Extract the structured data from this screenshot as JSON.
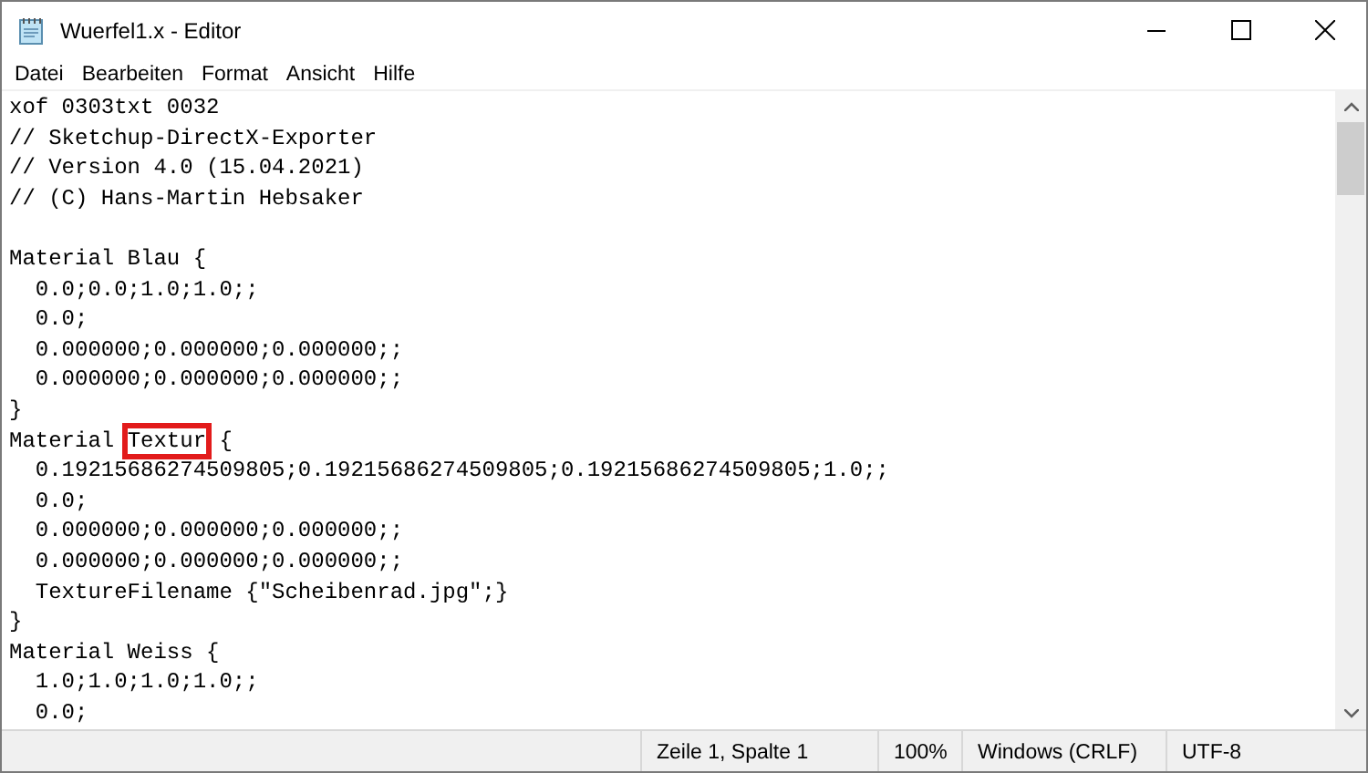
{
  "window": {
    "title": "Wuerfel1.x - Editor"
  },
  "menu": [
    "Datei",
    "Bearbeiten",
    "Format",
    "Ansicht",
    "Hilfe"
  ],
  "blocks": [
    [
      {
        "text": "xof 0303txt 0032"
      },
      {
        "text": "// Sketchup-DirectX-Exporter"
      },
      {
        "text": "// Version 4.0 (15.04.2021)"
      },
      {
        "text": "// (C) Hans-Martin Hebsaker"
      }
    ],
    [
      {
        "text": "Material Blau {"
      },
      {
        "text": "  0.0;0.0;1.0;1.0;;"
      },
      {
        "text": "  0.0;"
      },
      {
        "text": "  0.000000;0.000000;0.000000;;"
      },
      {
        "text": "  0.000000;0.000000;0.000000;;"
      },
      {
        "text": "}"
      },
      {
        "text": "Material ",
        "marked": "Textur",
        "after": " {"
      },
      {
        "text": "  0.19215686274509805;0.19215686274509805;0.19215686274509805;1.0;;"
      },
      {
        "text": "  0.0;"
      },
      {
        "text": "  0.000000;0.000000;0.000000;;"
      },
      {
        "text": "  0.000000;0.000000;0.000000;;"
      },
      {
        "text": "  TextureFilename {\"Scheibenrad.jpg\";}"
      },
      {
        "text": "}"
      },
      {
        "text": "Material Weiss {"
      },
      {
        "text": "  1.0;1.0;1.0;1.0;;"
      },
      {
        "text": "  0.0;"
      }
    ]
  ],
  "status_bar": [
    "Zeile 1, Spalte 1",
    "100%",
    "Windows (CRLF)",
    "UTF-8"
  ]
}
